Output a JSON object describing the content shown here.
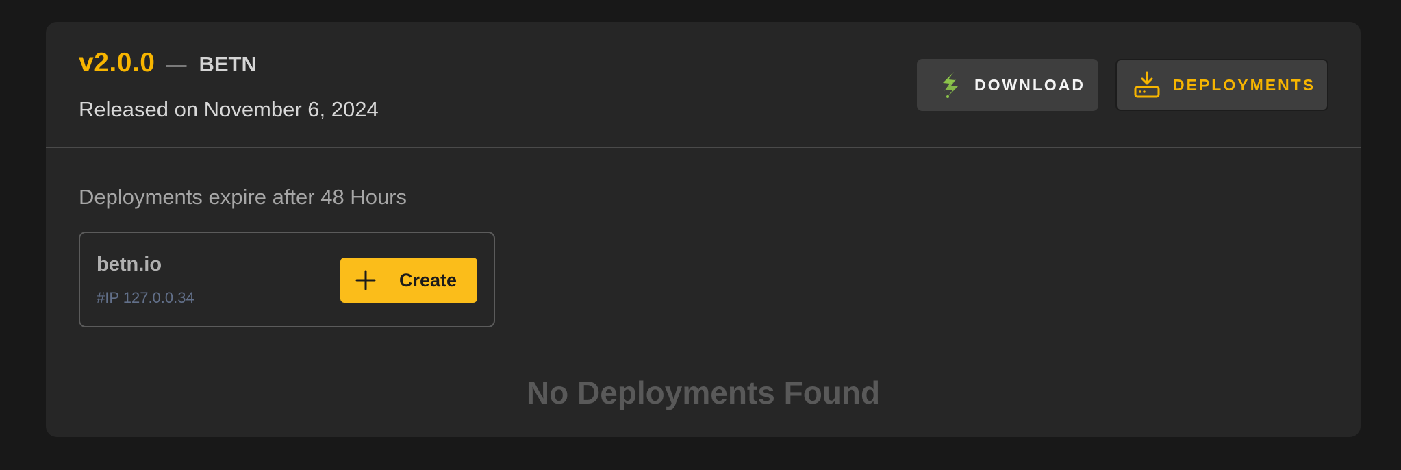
{
  "release": {
    "version": "v2.0.0",
    "separator": "—",
    "product": "BETN",
    "released_text": "Released on November 6, 2024"
  },
  "actions": {
    "download_label": "DOWNLOAD",
    "download_icon": "lightning-bolt-icon",
    "deployments_label": "DEPLOYMENTS",
    "deployments_icon": "download-tray-icon"
  },
  "deployments": {
    "expiry_note": "Deployments expire after 48 Hours",
    "target": {
      "domain": "betn.io",
      "ip": "#IP 127.0.0.34",
      "create_label": "Create",
      "create_icon": "plus-icon"
    },
    "empty_text": "No Deployments Found"
  },
  "colors": {
    "accent": "#f7b500",
    "create_button": "#fbbd1a",
    "card_background": "#262626",
    "page_background": "#181818",
    "bolt_icon": "#8bc34a"
  }
}
